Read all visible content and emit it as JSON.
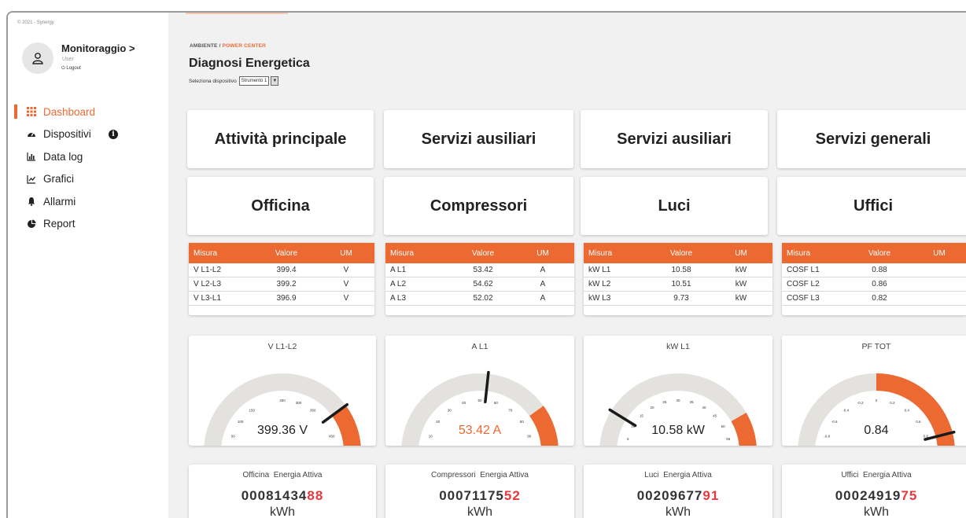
{
  "copyright": "© 2021 - Synergy",
  "user": {
    "name": "Monitoraggio",
    "chevron": ">",
    "role": "User",
    "logout": "Logout"
  },
  "menu": [
    {
      "label": "Dashboard",
      "icon": "grid-icon",
      "active": true
    },
    {
      "label": "Dispositivi",
      "icon": "gauge-icon",
      "active": false
    },
    {
      "label": "Data log",
      "icon": "barchart-icon",
      "active": false
    },
    {
      "label": "Grafici",
      "icon": "linechart-icon",
      "active": false
    },
    {
      "label": "Allarmi",
      "icon": "bell-icon",
      "active": false
    },
    {
      "label": "Report",
      "icon": "piechart-icon",
      "active": false
    }
  ],
  "info_glyph": "i",
  "breadcrumb": {
    "root": "AMBIENTE",
    "sep": "/",
    "current": "POWER CENTER"
  },
  "page_title": "Diagnosi Energetica",
  "device_select": {
    "label": "Seleziona dispositivo",
    "value": "Strumento 1",
    "arrow": "▼"
  },
  "accent_color": "#ec6a32",
  "categories": [
    "Attività principale",
    "Servizi ausiliari",
    "Servizi ausiliari",
    "Servizi generali"
  ],
  "subcategories": [
    "Officina",
    "Compressori",
    "Luci",
    "Uffici"
  ],
  "tables": [
    {
      "headers": [
        "Misura",
        "Valore",
        "UM"
      ],
      "rows": [
        [
          "V L1-L2",
          "399.4",
          "V"
        ],
        [
          "V L2-L3",
          "399.2",
          "V"
        ],
        [
          "V L3-L1",
          "396.9",
          "V"
        ]
      ]
    },
    {
      "headers": [
        "Misura",
        "Valore",
        "UM"
      ],
      "rows": [
        [
          "A L1",
          "53.42",
          "A"
        ],
        [
          "A L2",
          "54.62",
          "A"
        ],
        [
          "A L3",
          "52.02",
          "A"
        ]
      ]
    },
    {
      "headers": [
        "Misura",
        "Valore",
        "UM"
      ],
      "rows": [
        [
          "kW L1",
          "10.58",
          "kW"
        ],
        [
          "kW L2",
          "10.51",
          "kW"
        ],
        [
          "kW L3",
          "9.73",
          "kW"
        ]
      ]
    },
    {
      "headers": [
        "Misura",
        "Valore",
        "UM"
      ],
      "rows": [
        [
          "COSF L1",
          "0.88",
          ""
        ],
        [
          "COSF L2",
          "0.86",
          ""
        ],
        [
          "COSF L3",
          "0.82",
          ""
        ]
      ]
    }
  ],
  "gauges": [
    {
      "title": "V L1-L2",
      "display": "399.36 V",
      "value": 399.36,
      "min": 0,
      "max": 500,
      "band_from": 400,
      "band_to": 500,
      "value_color": "#222222",
      "ticks": [
        "0",
        "50",
        "100",
        "150",
        "250",
        "300",
        "350",
        "450",
        "500"
      ],
      "tick_values": [
        0,
        50,
        100,
        150,
        250,
        300,
        350,
        450,
        500
      ]
    },
    {
      "title": "A L1",
      "display": "53.42 A",
      "value": 53.42,
      "min": 0,
      "max": 100,
      "band_from": 80,
      "band_to": 100,
      "value_color": "#ec6a32",
      "ticks": [
        "0",
        "10",
        "20",
        "30",
        "40",
        "50",
        "60",
        "70",
        "80",
        "90",
        "100"
      ],
      "tick_values": [
        0,
        10,
        20,
        30,
        40,
        50,
        60,
        70,
        80,
        90,
        100
      ]
    },
    {
      "title": "kW L1",
      "display": "10.58 kW",
      "value": 10.58,
      "min": 0,
      "max": 60,
      "band_from": 50,
      "band_to": 60,
      "value_color": "#222222",
      "ticks": [
        "0",
        "5",
        "10",
        "15",
        "20",
        "25",
        "30",
        "35",
        "40",
        "45",
        "50",
        "55",
        "60"
      ],
      "tick_values": [
        0,
        5,
        10,
        15,
        20,
        25,
        30,
        35,
        40,
        45,
        50,
        55,
        60
      ]
    },
    {
      "title": "PF TOT",
      "display": "0.84",
      "value": 0.84,
      "min": -1,
      "max": 1,
      "band_from": 0,
      "band_to": 1,
      "value_color": "#222222",
      "ticks": [
        "-1.0",
        "-0.8",
        "-0.6",
        "-0.4",
        "-0.2",
        "0",
        "0.2",
        "0.4",
        "0.6",
        "0.8",
        "1.0"
      ],
      "tick_values": [
        -1,
        -0.8,
        -0.6,
        -0.4,
        -0.2,
        0,
        0.2,
        0.4,
        0.6,
        0.8,
        1
      ]
    }
  ],
  "energy": [
    {
      "name": "Officina",
      "label": "Energia Attiva",
      "digits": "00081434",
      "digits_hl": "88",
      "unit": "kWh"
    },
    {
      "name": "Compressori",
      "label": "Energia Attiva",
      "digits": "00071175",
      "digits_hl": "52",
      "unit": "kWh"
    },
    {
      "name": "Luci",
      "label": "Energia Attiva",
      "digits": "00209677",
      "digits_hl": "91",
      "unit": "kWh"
    },
    {
      "name": "Uffici",
      "label": "Energia Attiva",
      "digits": "00024919",
      "digits_hl": "75",
      "unit": "kWh"
    }
  ]
}
